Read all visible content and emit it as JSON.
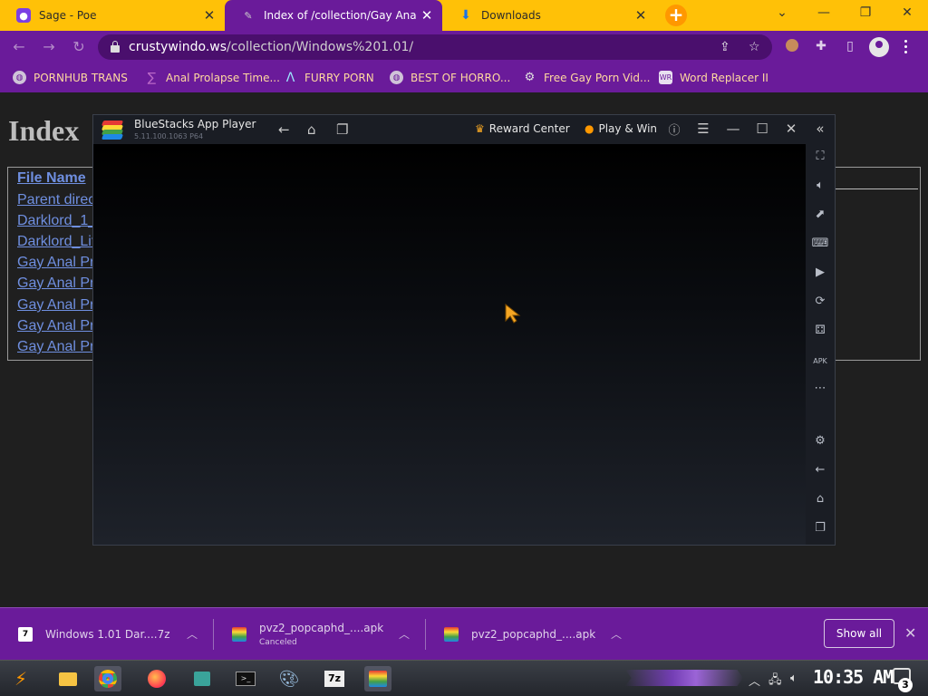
{
  "tabs": [
    {
      "title": "Sage - Poe",
      "icon": "poe-icon"
    },
    {
      "title": "Index of /collection/Gay Anal P",
      "icon": "site-icon"
    },
    {
      "title": "Downloads",
      "icon": "download-icon"
    }
  ],
  "address": {
    "domain": "crustywindo.ws",
    "path": "/collection/Windows%201.01/"
  },
  "bookmarks": [
    {
      "label": "PORNHUB TRANS",
      "icon": "globe-icon"
    },
    {
      "label": "Anal Prolapse Time...",
      "icon": "bookmark-icon"
    },
    {
      "label": "FURRY PORN",
      "icon": "arch-icon"
    },
    {
      "label": "BEST OF HORRO...",
      "icon": "globe-icon"
    },
    {
      "label": "Free Gay Porn Vid...",
      "icon": "cog-icon"
    },
    {
      "label": "Word Replacer II",
      "icon": "wr-icon"
    }
  ],
  "page": {
    "title": "Index",
    "column_header": "File Name",
    "rows": [
      "Parent direc",
      "Darklord_1_",
      "Darklord_Lit",
      "Gay Anal Pr",
      "Gay Anal Pr",
      "Gay Anal Pr",
      "Gay Anal Pr",
      "Gay Anal Pr"
    ]
  },
  "bluestacks": {
    "app_name": "BlueStacks App Player",
    "version": "5.11.100.1063  P64",
    "reward_center": "Reward Center",
    "play_win": "Play & Win"
  },
  "downloads": [
    {
      "name": "Windows 1.01 Dar....7z",
      "status": ""
    },
    {
      "name": "pvz2_popcaphd_....apk",
      "status": "Canceled"
    },
    {
      "name": "pvz2_popcaphd_....apk",
      "status": ""
    }
  ],
  "download_bar": {
    "show_all": "Show all"
  },
  "taskbar": {
    "clock": "10:35 AM",
    "notifications": "3"
  },
  "colors": {
    "accent": "#6a1b9a",
    "tabstrip": "#ffc107",
    "link": "#6f8fe0",
    "bookmark_text": "#ffd9a0"
  }
}
